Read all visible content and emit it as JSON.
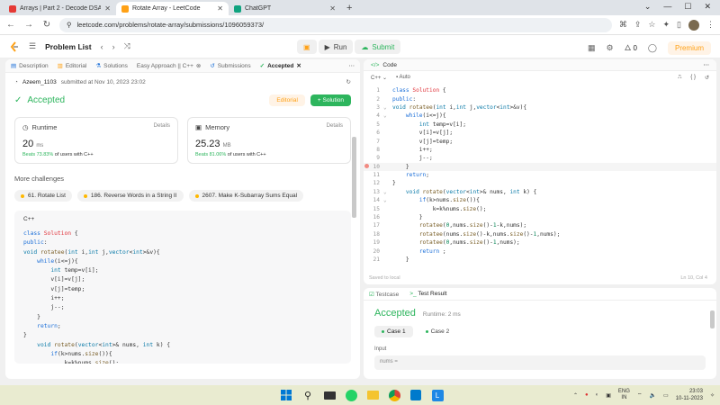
{
  "browser": {
    "tabs": [
      {
        "title": "Arrays | Part 2 - Decode DSA wit",
        "color": "#e53935",
        "active": false
      },
      {
        "title": "Rotate Array - LeetCode",
        "color": "#ffa116",
        "active": true
      },
      {
        "title": "ChatGPT",
        "color": "#10a37f",
        "active": false
      }
    ],
    "url": "leetcode.com/problems/rotate-array/submissions/1096059373/"
  },
  "header": {
    "problem_list": "Problem List",
    "run": "Run",
    "submit": "Submit",
    "fire_count": "0",
    "premium": "Premium"
  },
  "left_tabs": [
    "Description",
    "Editorial",
    "Solutions",
    "Easy Approach || C++",
    "Submissions",
    "Accepted"
  ],
  "submission": {
    "author": "Azeem_1103",
    "submitted": "submitted at Nov 10, 2023 23:02",
    "status": "Accepted",
    "editorial": "Editorial",
    "solution": "Solution"
  },
  "runtime": {
    "label": "Runtime",
    "details": "Details",
    "value": "20",
    "unit": "ms",
    "beats": "Beats 73.83%",
    "beats_tail": "of users with C++"
  },
  "memory": {
    "label": "Memory",
    "details": "Details",
    "value": "25.23",
    "unit": "MB",
    "beats": "Beats 81.06%",
    "beats_tail": "of users with C++"
  },
  "more_challenges": "More challenges",
  "challenges": [
    "61. Rotate List",
    "186. Reverse Words in a String II",
    "2607. Make K-Subarray Sums Equal"
  ],
  "left_code_lang": "C++",
  "left_code": [
    "class Solution {",
    "public:",
    "void rotatee(int i,int j,vector<int>&v){",
    "    while(i<=j){",
    "        int temp=v[i];",
    "        v[i]=v[j];",
    "        v[j]=temp;",
    "        i++;",
    "        j--;",
    "    }",
    "    return;",
    "}",
    "    void rotate(vector<int>& nums, int k) {",
    "        if(k>nums.size()){",
    "            k=k%nums.size();",
    "        }"
  ],
  "editor": {
    "tab": "Code",
    "lang": "C++",
    "mode": "Auto",
    "saved": "Saved to local",
    "cursor": "Ln 10, Col 4",
    "lines": [
      "class Solution {",
      "public:",
      "void rotatee(int i,int j,vector<int>&v){",
      "    while(i<=j){",
      "        int temp=v[i];",
      "        v[i]=v[j];",
      "        v[j]=temp;",
      "        i++;",
      "        j--;",
      "    }",
      "    return;",
      "}",
      "    void rotate(vector<int>& nums, int k) {",
      "        if(k>nums.size()){",
      "            k=k%nums.size();",
      "        }",
      "        rotatee(0,nums.size()-1-k,nums);",
      "        rotatee(nums.size()-k,nums.size()-1,nums);",
      "        rotatee(0,nums.size()-1,nums);",
      "        return ;",
      "    }"
    ]
  },
  "result": {
    "testcase_tab": "Testcase",
    "result_tab": "Test Result",
    "status": "Accepted",
    "runtime": "Runtime: 2 ms",
    "cases": [
      "Case 1",
      "Case 2"
    ],
    "input_label": "Input",
    "input_value": "nums ="
  },
  "taskbar": {
    "lang1": "ENG",
    "lang2": "IN",
    "time": "23:03",
    "date": "10-11-2023"
  }
}
